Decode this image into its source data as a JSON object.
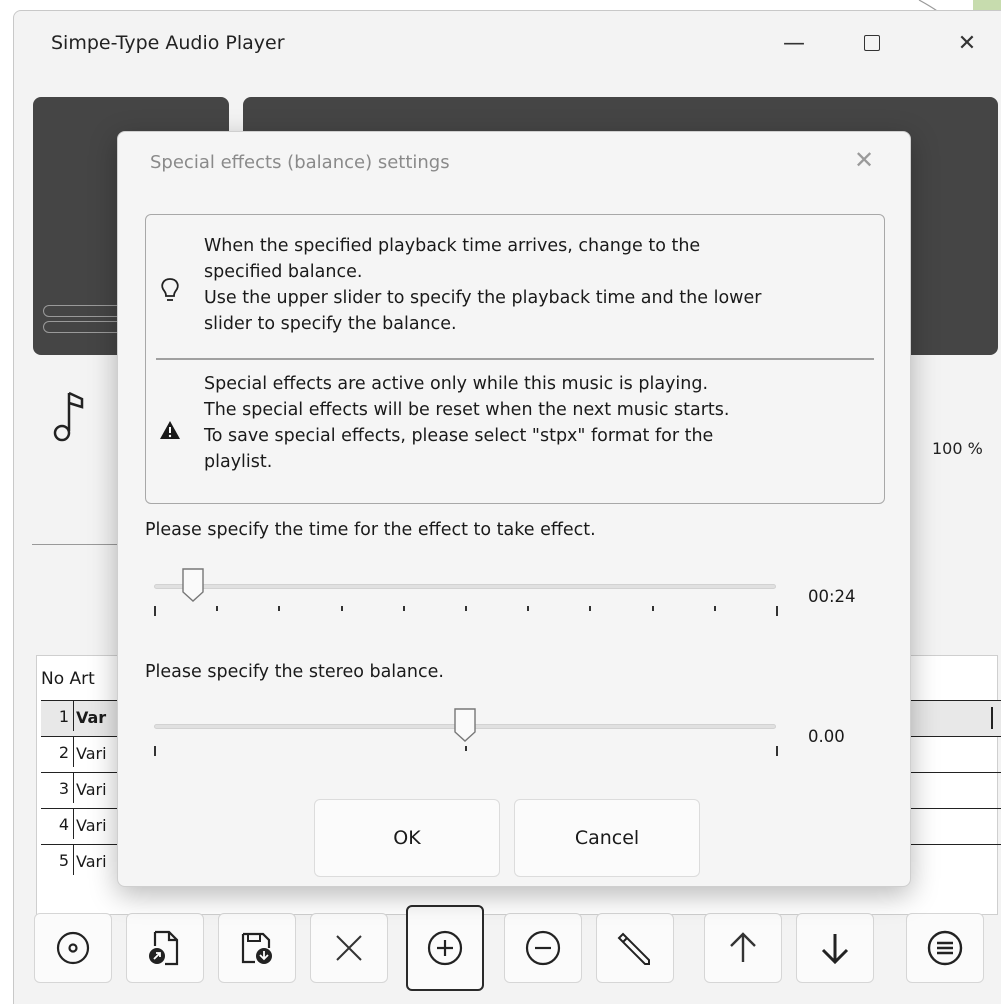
{
  "window": {
    "title": "Simpe-Type Audio Player",
    "minimize": "—",
    "close": "✕"
  },
  "player": {
    "volume": "100 %"
  },
  "playlist": {
    "header": "No Art",
    "rows": [
      {
        "no": "1",
        "artist": "Var"
      },
      {
        "no": "2",
        "artist": "Vari"
      },
      {
        "no": "3",
        "artist": "Vari"
      },
      {
        "no": "4",
        "artist": "Vari"
      },
      {
        "no": "5",
        "artist": "Vari"
      }
    ]
  },
  "toolbar": {
    "buttons": [
      "disc-icon",
      "open-file-icon",
      "save-file-icon",
      "delete-icon",
      "add-icon",
      "remove-icon",
      "edit-icon",
      "up-arrow-icon",
      "down-arrow-icon",
      "menu-icon"
    ]
  },
  "dialog": {
    "title": "Special effects (balance) settings",
    "close": "✕",
    "info1": [
      "When the specified playback time arrives, change to the",
      "specified balance.",
      "Use the upper slider to specify the playback time and the lower",
      "slider to specify the balance."
    ],
    "info2": [
      "Special effects are active only while this music is playing.",
      "The special effects will be reset when the next music starts.",
      "To save special effects, please select \"stpx\" format for the",
      "playlist."
    ],
    "time_label": "Please specify the time for the effect to take effect.",
    "time_value": "00:24",
    "time_position": 0.062,
    "balance_label": "Please specify the stereo balance.",
    "balance_value": "0.00",
    "balance_position": 0.5,
    "ok": "OK",
    "cancel": "Cancel"
  }
}
